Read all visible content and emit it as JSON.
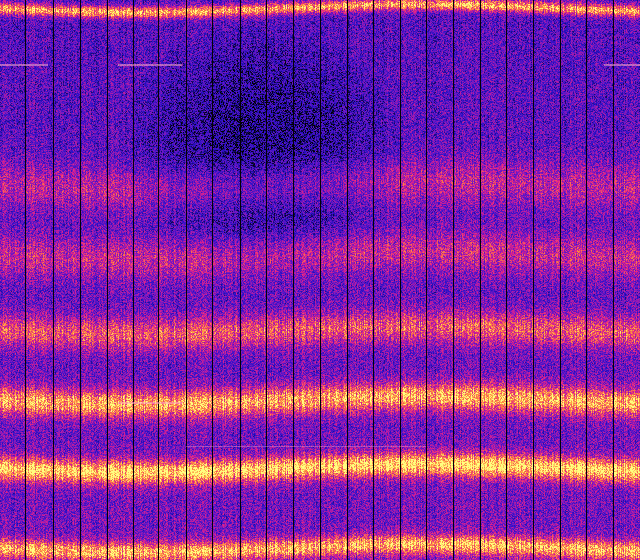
{
  "image": {
    "kind": "spectrogram-waterfall",
    "colormap": [
      "#000000",
      "#2a10c8",
      "#7a18c0",
      "#e0208a",
      "#ff8a3c",
      "#ffff80"
    ],
    "background_color": "#1a0fa0",
    "separator_color": "#050008"
  }
}
